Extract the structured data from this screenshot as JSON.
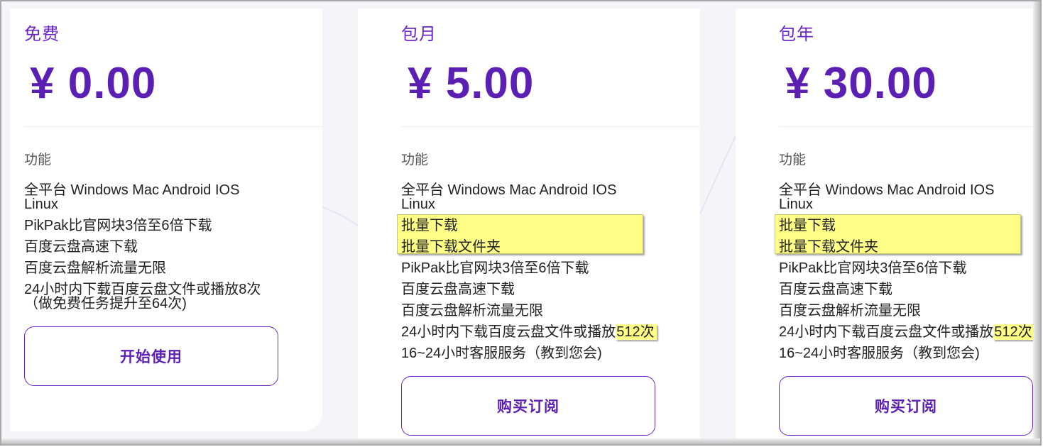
{
  "plans": [
    {
      "name": "免费",
      "price": "¥ 0.00",
      "features_label": "功能",
      "features": [
        "全平台 Windows Mac Android IOS",
        "Linux",
        "PikPak比官网块3倍至6倍下载",
        "百度云盘高速下载",
        "百度云盘解析流量无限",
        "24小时内下载百度云盘文件或播放8次",
        "（做免费任务提升至64次)"
      ],
      "button_label": "开始使用"
    },
    {
      "name": "包月",
      "price": "¥ 5.00",
      "features_label": "功能",
      "features": [
        "全平台 Windows Mac Android IOS",
        "Linux",
        "批量下载",
        "批量下载文件夹",
        "PikPak比官网块3倍至6倍下载",
        "百度云盘高速下载",
        "百度云盘解析流量无限",
        "24小时内下载百度云盘文件或播放",
        "512次",
        "16~24小时客服服务（教到您会)"
      ],
      "button_label": "购买订阅"
    },
    {
      "name": "包年",
      "price": "¥ 30.00",
      "features_label": "功能",
      "features": [
        "全平台 Windows Mac Android IOS",
        "Linux",
        "批量下载",
        "批量下载文件夹",
        "PikPak比官网块3倍至6倍下载",
        "百度云盘高速下载",
        "百度云盘解析流量无限",
        "24小时内下载百度云盘文件或播放",
        "512次",
        "16~24小时客服服务（教到您会)"
      ],
      "button_label": "购买订阅"
    }
  ],
  "colors": {
    "accent": "#6b26c7",
    "price": "#5b1fb3",
    "highlight": "#ffff88",
    "page_bg": "#f5f4f9"
  }
}
